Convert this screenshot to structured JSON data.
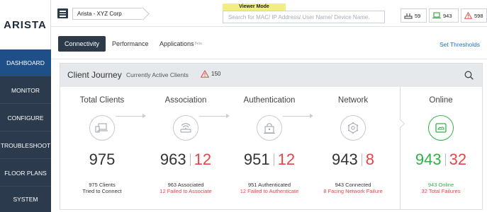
{
  "brand": {
    "logo": "ARISTA"
  },
  "sidebar": {
    "items": [
      {
        "label": "DASHBOARD",
        "active": true
      },
      {
        "label": "MONITOR",
        "active": false
      },
      {
        "label": "CONFIGURE",
        "active": false
      },
      {
        "label": "TROUBLESHOOT",
        "active": false
      },
      {
        "label": "FLOOR PLANS",
        "active": false
      },
      {
        "label": "SYSTEM",
        "active": false
      }
    ]
  },
  "topbar": {
    "org": "Arista - XYZ Corp",
    "viewer_mode": "Viewer Mode",
    "search_placeholder": "Search for MAC/ IP Address/ User Name/ Device Name.",
    "stats": [
      {
        "icon": "access-point-icon",
        "value": "59"
      },
      {
        "icon": "laptop-icon",
        "value": "943"
      },
      {
        "icon": "alert-icon",
        "value": "598"
      }
    ]
  },
  "tabs": [
    {
      "label": "Connectivity",
      "active": true
    },
    {
      "label": "Performance",
      "active": false
    },
    {
      "label": "Applications",
      "badge": "Beta",
      "active": false
    }
  ],
  "set_thresholds": "Set Thresholds",
  "journey": {
    "title": "Client Journey",
    "subtitle": "Currently Active Clients",
    "alert_count": "150",
    "stages": [
      {
        "name": "Total Clients",
        "icon": "clients-icon",
        "count": "975",
        "fail": "",
        "desc1": "975 Clients",
        "desc2": "Tried to Connect"
      },
      {
        "name": "Association",
        "icon": "router-icon",
        "count": "963",
        "fail": "12",
        "desc1": "963 Associated",
        "desc2": "12 Failed to Associate"
      },
      {
        "name": "Authentication",
        "icon": "lock-icon",
        "count": "951",
        "fail": "12",
        "desc1": "951 Authenticated",
        "desc2": "12 Failed to Authenticate"
      },
      {
        "name": "Network",
        "icon": "network-icon",
        "count": "943",
        "fail": "8",
        "desc1": "943 Connected",
        "desc2": "8 Facing Network Failure"
      },
      {
        "name": "Online",
        "icon": "online-icon",
        "count": "943",
        "fail": "32",
        "desc1": "943 Online",
        "desc2": "32 Total Failures"
      }
    ]
  },
  "colors": {
    "sidebar": "#2b3a4c",
    "active_nav": "#1f4f87",
    "fail": "#e54545",
    "online": "#2fb344",
    "link": "#1a73c6"
  }
}
